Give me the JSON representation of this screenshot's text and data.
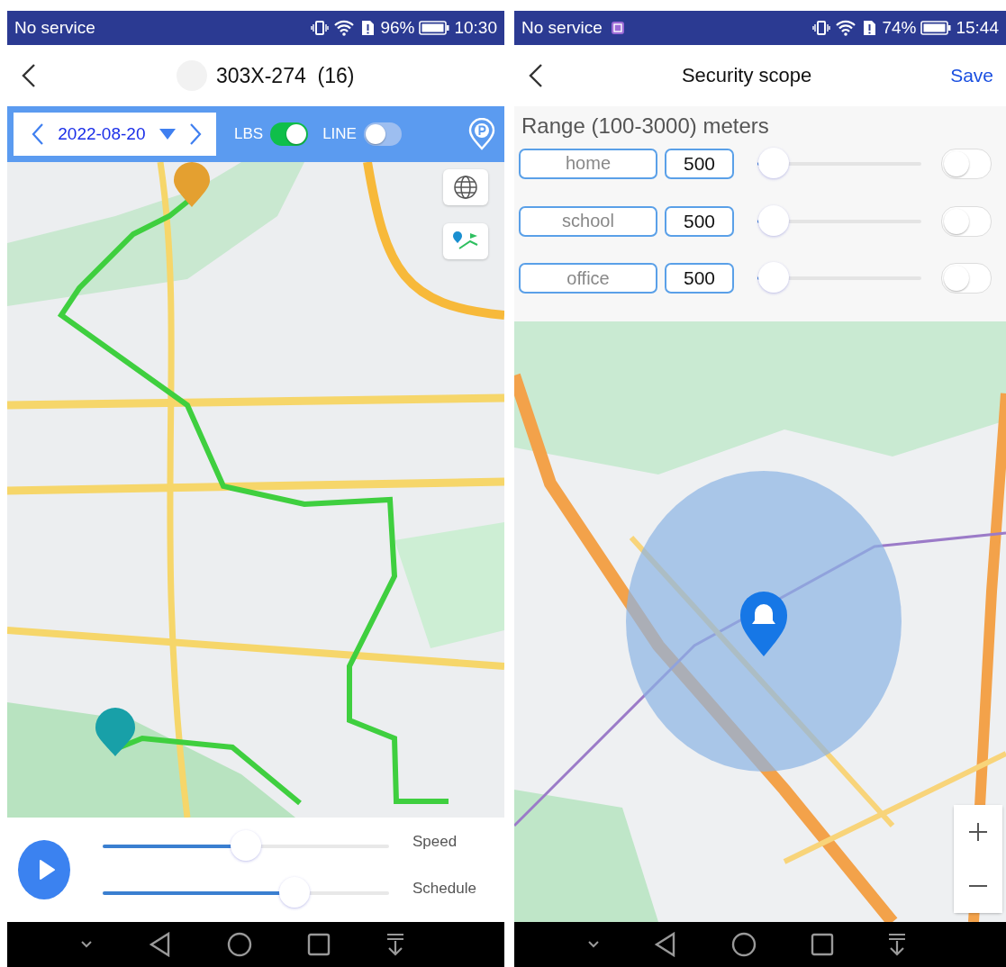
{
  "screens": [
    {
      "status_bar": {
        "carrier": "No service",
        "battery_text": "96%",
        "time": "10:30"
      },
      "header": {
        "title": "303X-274  (16)"
      },
      "toolbar": {
        "date": "2022-08-20",
        "toggles": [
          {
            "label": "LBS",
            "on": true
          },
          {
            "label": "LINE",
            "on": false
          }
        ]
      },
      "playback": {
        "sliders": [
          {
            "label": "Speed",
            "level": 0.5
          },
          {
            "label": "Schedule",
            "level": 0.67
          }
        ]
      }
    },
    {
      "status_bar": {
        "carrier": "No service",
        "notification": true,
        "battery_text": "74%",
        "time": "15:44"
      },
      "header": {
        "title": "Security scope",
        "action": "Save"
      },
      "range_label": "Range (100-3000) meters",
      "zones": [
        {
          "name": "home",
          "value": "500",
          "level": 0.1,
          "on": false
        },
        {
          "name": "school",
          "value": "500",
          "level": 0.1,
          "on": false
        },
        {
          "name": "office",
          "value": "500",
          "level": 0.1,
          "on": false
        }
      ]
    }
  ]
}
